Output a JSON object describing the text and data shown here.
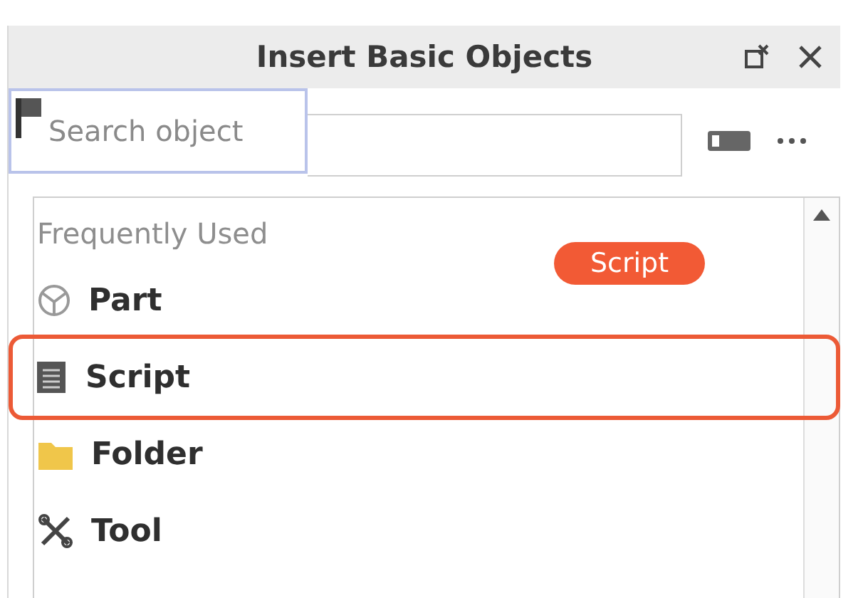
{
  "window": {
    "title": "Insert Basic Objects"
  },
  "search": {
    "placeholder": "Search object"
  },
  "list": {
    "section": "Frequently Used",
    "items": [
      {
        "label": "Part",
        "kind": "part",
        "highlighted": false
      },
      {
        "label": "Script",
        "kind": "script",
        "highlighted": true
      },
      {
        "label": "Folder",
        "kind": "folder",
        "highlighted": false
      },
      {
        "label": "Tool",
        "kind": "tool",
        "highlighted": false
      }
    ]
  },
  "callout": {
    "text": "Script"
  }
}
